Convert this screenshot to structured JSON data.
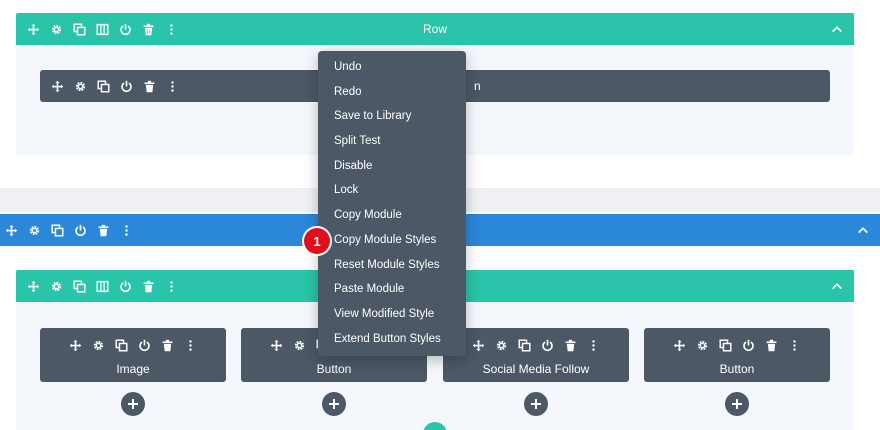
{
  "row_top": {
    "title": "Row"
  },
  "module_top": {
    "title_fragment": "n"
  },
  "section": {
    "title": ""
  },
  "row_bottom": {
    "title": ""
  },
  "modules": [
    {
      "label": "Image"
    },
    {
      "label": "Button"
    },
    {
      "label": "Social Media Follow"
    },
    {
      "label": "Button"
    }
  ],
  "context_menu": {
    "items": [
      "Undo",
      "Redo",
      "Save to Library",
      "Split Test",
      "Disable",
      "Lock",
      "Copy Module",
      "Copy Module Styles",
      "Reset Module Styles",
      "Paste Module",
      "View Modified Style",
      "Extend Button Styles"
    ]
  },
  "callout": {
    "number": "1"
  },
  "colors": {
    "row_bar": "#29c4a9",
    "section_bar": "#2b87da",
    "module_bar": "#4c5866",
    "badge": "#e0101a"
  }
}
